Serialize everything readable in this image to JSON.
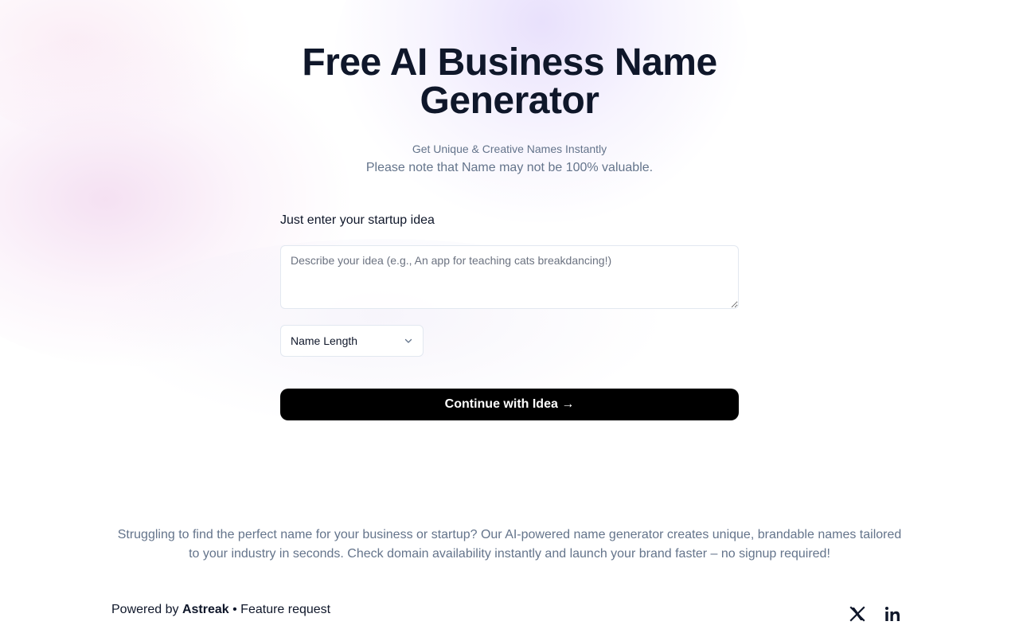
{
  "hero": {
    "title": "Free AI Business Name Generator",
    "subtitle": "Get Unique & Creative Names Instantly",
    "note": "Please note that Name may not be 100% valuable."
  },
  "form": {
    "label": "Just enter your startup idea",
    "idea_placeholder": "Describe your idea (e.g., An app for teaching cats breakdancing!)",
    "idea_value": "",
    "length_select": {
      "selected": "Name Length",
      "icon": "chevron-down-icon"
    },
    "continue_label": "Continue with Idea →"
  },
  "description": "Struggling to find the perfect name for your business or startup? Our AI-powered name generator creates unique, brandable names tailored to your industry in seconds. Check domain availability instantly and launch your brand faster – no signup required!",
  "footer": {
    "powered_prefix": "Powered by",
    "brand": "Astreak",
    "separator": "•",
    "feature_request": "Feature request",
    "social": [
      "x-icon",
      "linkedin-icon"
    ]
  },
  "colors": {
    "text_primary": "#0f172a",
    "text_muted": "#64748b",
    "button_bg": "#000000",
    "button_text": "#ffffff",
    "border": "#e2e8f0"
  }
}
